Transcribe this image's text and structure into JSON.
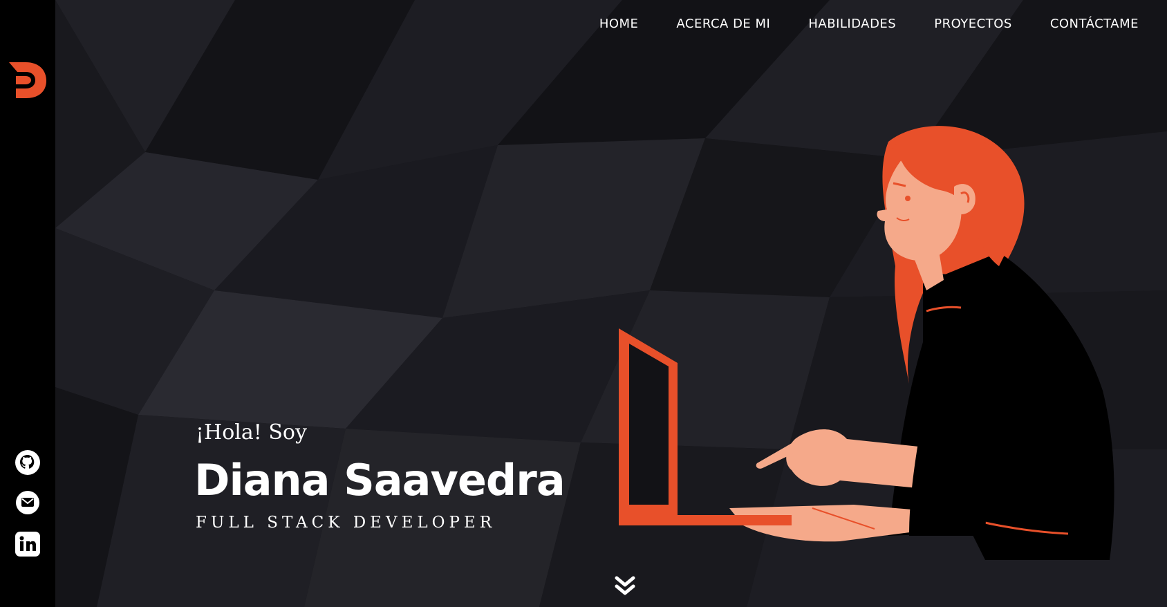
{
  "nav": {
    "items": [
      "HOME",
      "ACERCA DE MI",
      "HABILIDADES",
      "PROYECTOS",
      "CONTÁCTAME"
    ]
  },
  "hero": {
    "greeting": "¡Hola! Soy",
    "name": "Diana Saavedra",
    "role": "FULL STACK DEVELOPER"
  },
  "sidebar": {
    "logo_icon": "logo-d-icon",
    "social_icons": [
      "github-icon",
      "mail-icon",
      "linkedin-icon"
    ]
  },
  "colors": {
    "accent": "#e8502a",
    "background": "#141418",
    "sidebar": "#000000",
    "text": "#ffffff",
    "skin": "#f5a98a"
  }
}
